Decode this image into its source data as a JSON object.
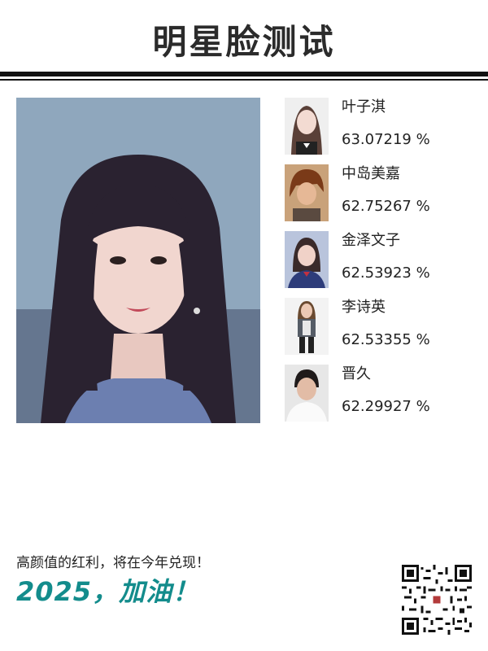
{
  "header": {
    "title": "明星脸测试"
  },
  "matches": [
    {
      "name": "叶子淇",
      "score": "63.07219 %"
    },
    {
      "name": "中岛美嘉",
      "score": "62.75267 %"
    },
    {
      "name": "金泽文子",
      "score": "62.53923 %"
    },
    {
      "name": "李诗英",
      "score": "62.53355 %"
    },
    {
      "name": "晋久",
      "score": "62.29927 %"
    }
  ],
  "footer": {
    "caption": "高颜值的红利，将在今年兑现！",
    "slogan": "2025，加油！"
  },
  "colors": {
    "accent": "#138c8c",
    "title": "#2b2b2b"
  }
}
